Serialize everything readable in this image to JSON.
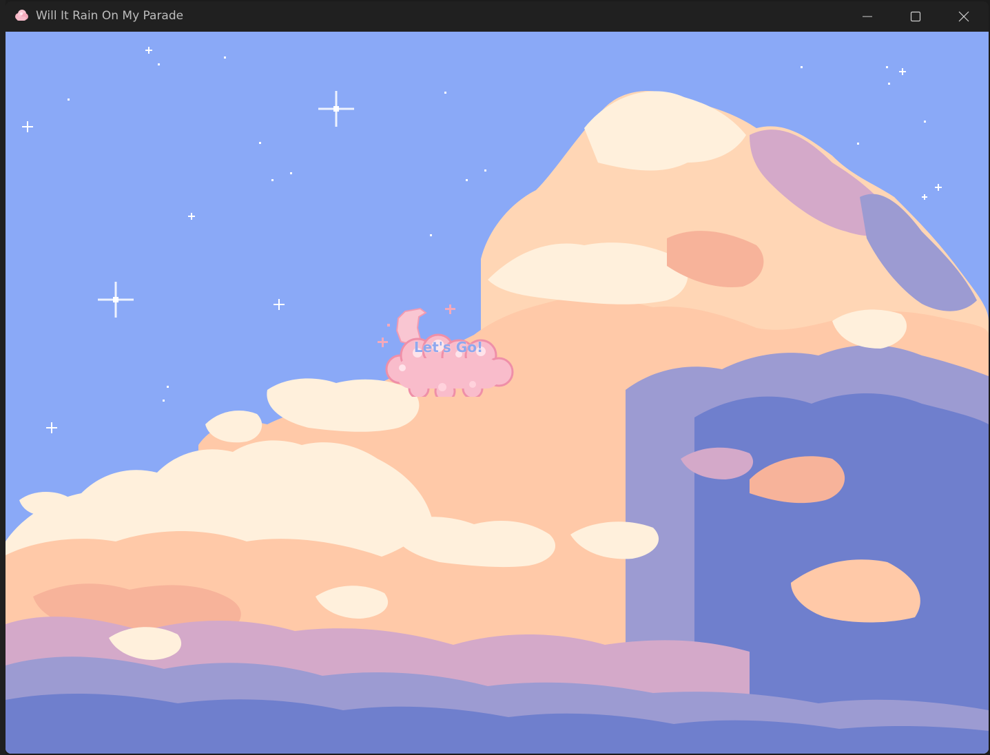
{
  "window": {
    "title": "Will It Rain On My Parade",
    "app_icon": "pink-cloud-icon",
    "controls": [
      "minimize-icon",
      "maximize-icon",
      "close-icon"
    ]
  },
  "scene": {
    "background": "pixel-art-sky-with-clouds",
    "sky_color": "#8aa9f7",
    "cloud_colors": [
      "#fff0dc",
      "#ffc9a8",
      "#f7b39a",
      "#d4a9c9",
      "#9c9bd2",
      "#6f7fcd"
    ]
  },
  "start_button": {
    "label": "Let's Go!",
    "icon": "pink-cloud-moon-icon",
    "text_color": "#8fa8ee"
  }
}
